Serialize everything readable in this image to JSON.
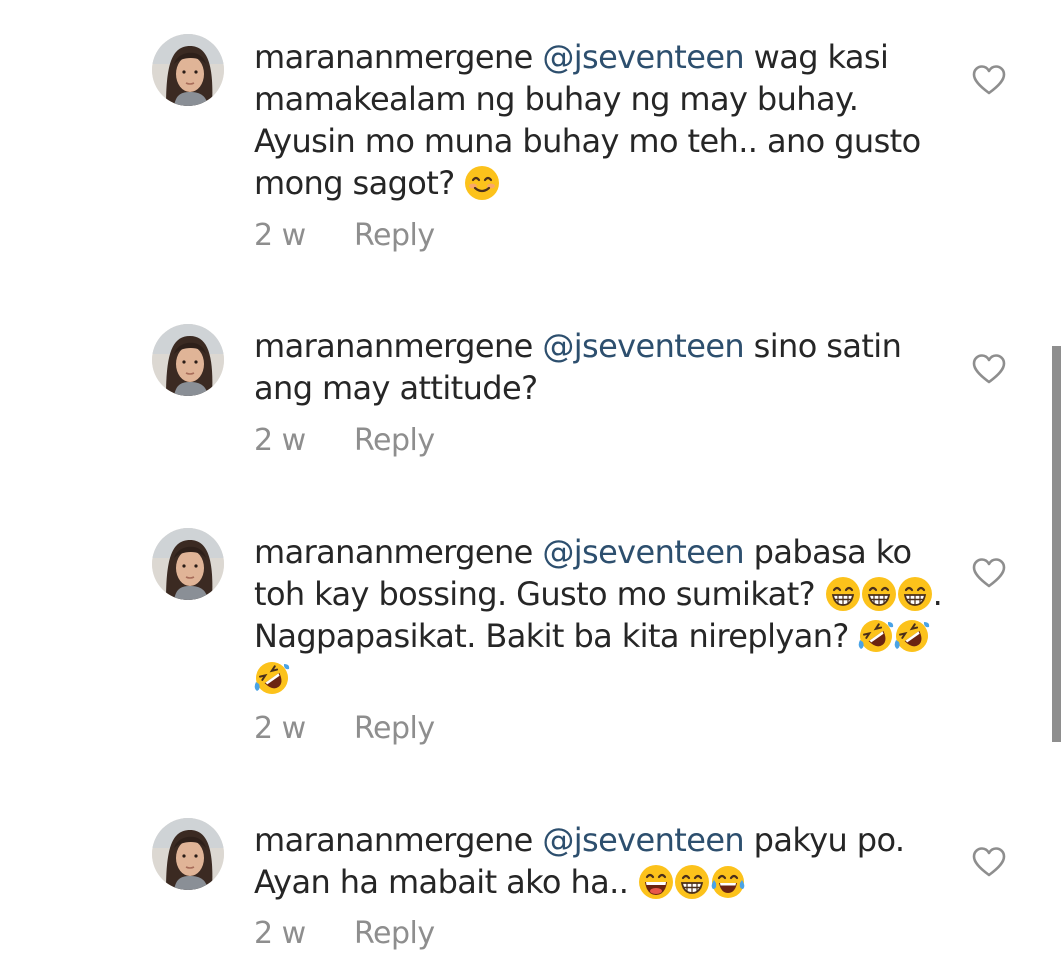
{
  "comments": [
    {
      "username": "maranan​mergene",
      "mention": "@jseventeen",
      "text_1": " wag kasi mamakealam ng buhay ng may buhay. Ayusin mo muna buhay mo teh.. ano gusto mong sagot? ",
      "emojis_1": [
        "smiling-face"
      ],
      "text_2": "",
      "emojis_2": [],
      "time": "2 w",
      "reply": "Reply"
    },
    {
      "username": "maranan​mergene",
      "mention": "@jseventeen",
      "text_1": " sino satin ang may attitude?",
      "emojis_1": [],
      "text_2": "",
      "emojis_2": [],
      "time": "2 w",
      "reply": "Reply"
    },
    {
      "username": "maranan​mergene",
      "mention": "@jseventeen",
      "text_1": " pabasa ko toh kay bossing. Gusto mo sumikat? ",
      "emojis_1": [
        "grinning-face",
        "grinning-face",
        "grinning-face"
      ],
      "text_2": ". Nagpapasikat. Bakit ba kita nireplyan? ",
      "emojis_2": [
        "rofl-face",
        "rofl-face",
        "rofl-face"
      ],
      "time": "2 w",
      "reply": "Reply"
    },
    {
      "username": "maranan​mergene",
      "mention": "@jseventeen",
      "text_1": " pakyu po. Ayan ha mabait ako ha.. ",
      "emojis_1": [
        "laughing-face",
        "grinning-face",
        "tears-of-joy-face"
      ],
      "text_2": "",
      "emojis_2": [],
      "time": "2 w",
      "reply": "Reply"
    }
  ],
  "colors": {
    "text": "#262626",
    "mention": "#2d4f6e",
    "meta": "#8e8e8e",
    "emoji_face": "#fcc21b"
  }
}
